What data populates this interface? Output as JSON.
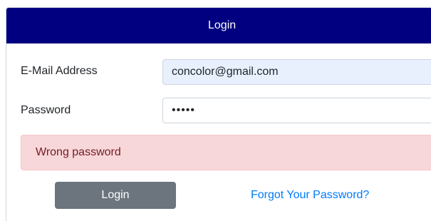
{
  "header": {
    "title": "Login"
  },
  "form": {
    "email_label": "E-Mail Address",
    "email_value": "concolor@gmail.com",
    "password_label": "Password",
    "password_value": "•••••"
  },
  "alert": {
    "message": "Wrong password"
  },
  "actions": {
    "login_label": "Login",
    "forgot_label": "Forgot Your Password?"
  },
  "colors": {
    "header_bg": "#000080",
    "autofill_bg": "#e8f0fe",
    "alert_bg": "#f8d7da",
    "alert_text": "#721c24",
    "button_bg": "#6c757d",
    "link": "#007bff"
  }
}
